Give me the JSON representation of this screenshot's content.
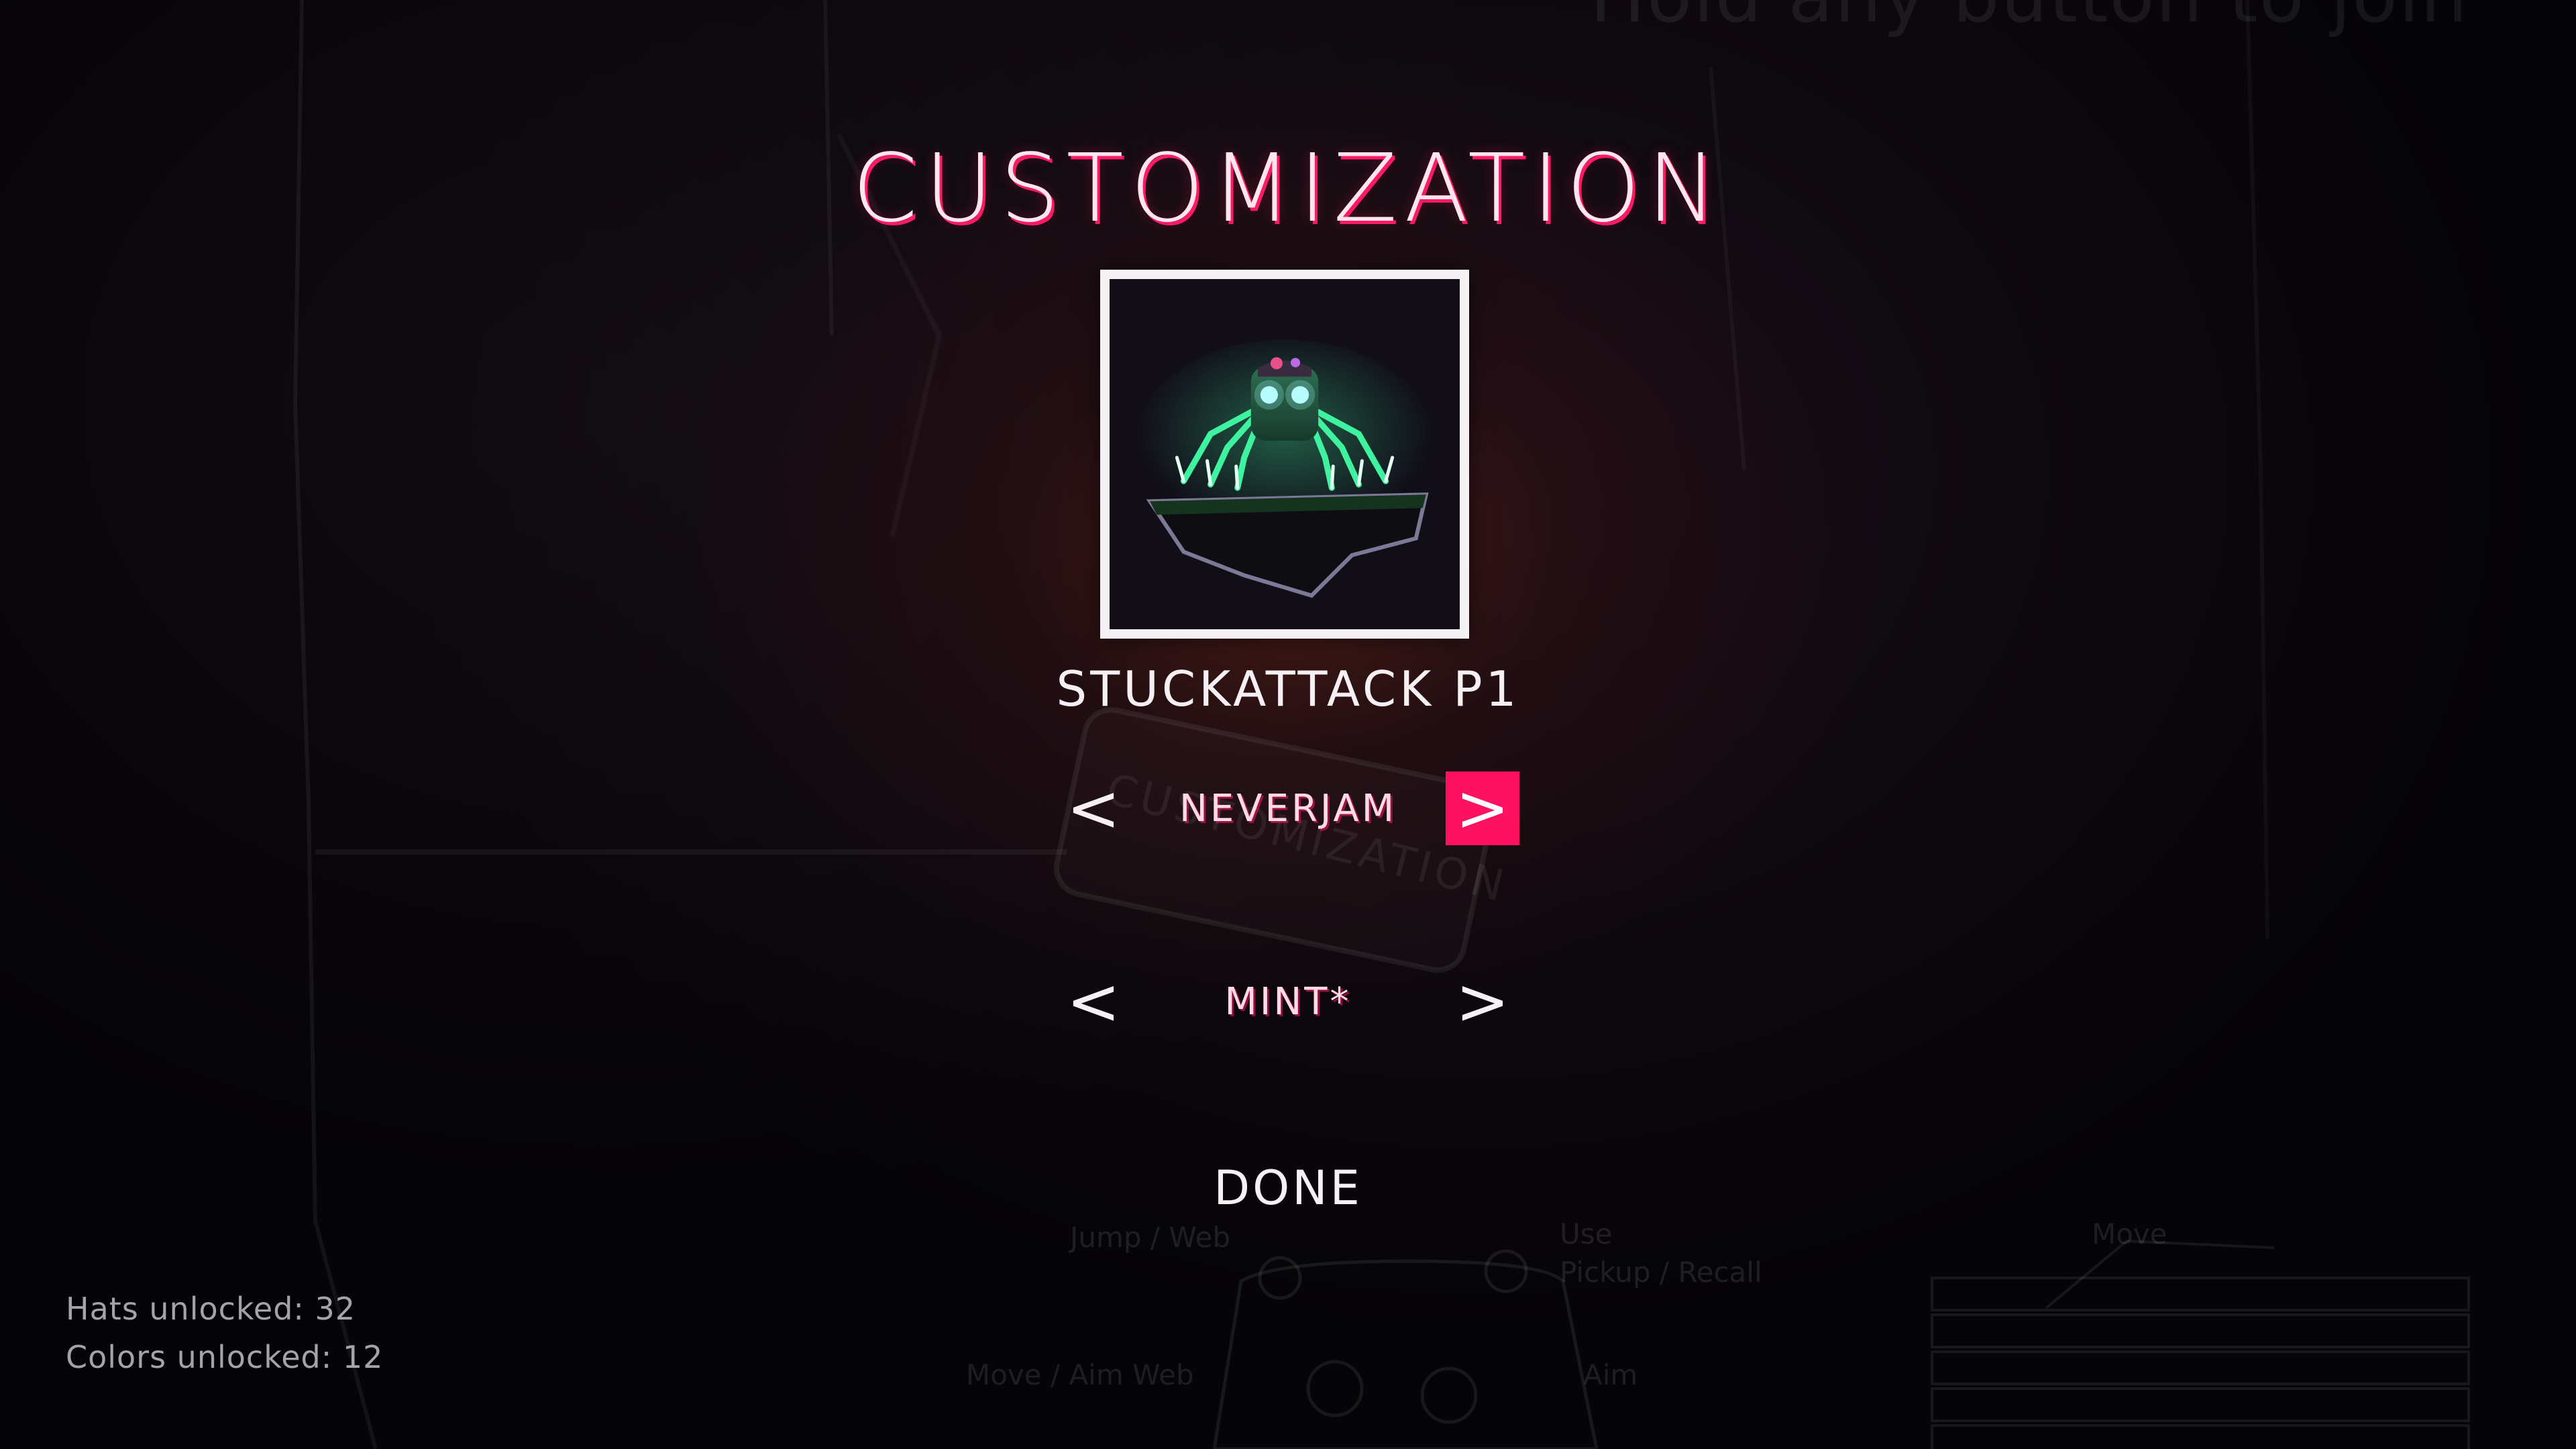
{
  "background": {
    "join_hint": "Hold any button to join",
    "sign_text": "CUSTOMIZATION",
    "controls_overlay": {
      "jump_web": "Jump / Web",
      "use": "Use",
      "pickup_recall": "Pickup / Recall",
      "move_aim_web": "Move / Aim Web",
      "aim": "Aim",
      "move": "Move"
    }
  },
  "menu": {
    "title": "CUSTOMIZATION",
    "player_name": "STUCKATTACK P1",
    "hat_selector": {
      "prev_label": "<",
      "value": "NEVERJAM",
      "next_label": ">"
    },
    "color_selector": {
      "prev_label": "<",
      "value": "MINT*",
      "next_label": ">"
    },
    "done_label": "DONE"
  },
  "stats": {
    "hats_unlocked": "Hats unlocked: 32",
    "colors_unlocked": "Colors unlocked: 12"
  },
  "colors": {
    "accent": "#ff1162",
    "mint": "#3ff2a0"
  },
  "icons": {
    "character_preview": "spider-character-icon",
    "gamepad": "gamepad-icon",
    "keyboard": "keyboard-icon"
  }
}
